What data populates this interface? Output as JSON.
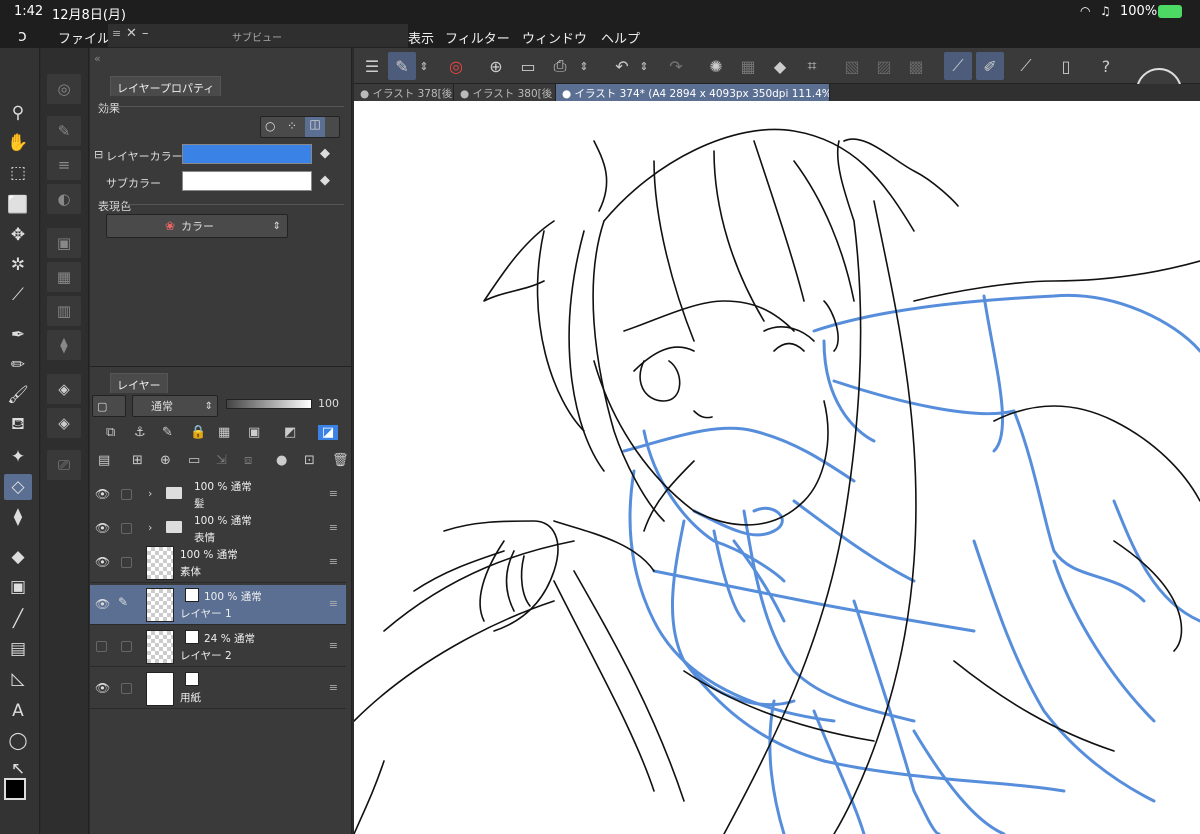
{
  "status": {
    "time": "1:42",
    "date": "12月8日(月)",
    "battery": "100%"
  },
  "menu": {
    "file": "ファイル",
    "view": "表示",
    "filter": "フィルター",
    "window": "ウィンドウ",
    "help": "ヘルプ"
  },
  "subview": {
    "title": "サブビュー"
  },
  "tabs": [
    {
      "label": "● イラスト 378[後"
    },
    {
      "label": "● イラスト 380[後"
    },
    {
      "label": "● イラスト 374* (A4 2894 x 4093px 350dpi 111.4%)"
    }
  ],
  "props": {
    "tab": "レイヤープロパティ",
    "effect": "効果",
    "layer_color": "レイヤーカラー",
    "sub_color": "サブカラー",
    "expression": "表現色",
    "expression_value": "カラー",
    "layer_color_hex": "#3a82e6",
    "sub_color_hex": "#ffffff"
  },
  "layers_panel": {
    "tab": "レイヤー",
    "blend": "通常",
    "opacity": "100",
    "layers": [
      {
        "opacity": "100 %  通常",
        "name": "髪"
      },
      {
        "opacity": "100 %  通常",
        "name": "表情"
      },
      {
        "opacity": "100 %  通常",
        "name": "素体"
      },
      {
        "opacity": "100 %  通常",
        "name": "レイヤー 1"
      },
      {
        "opacity": "24 %  通常",
        "name": "レイヤー 2"
      },
      {
        "opacity": "",
        "name": "用紙"
      }
    ]
  },
  "colors": {
    "accent": "#5b6f93",
    "sketch_blue": "#3a7bd5"
  }
}
